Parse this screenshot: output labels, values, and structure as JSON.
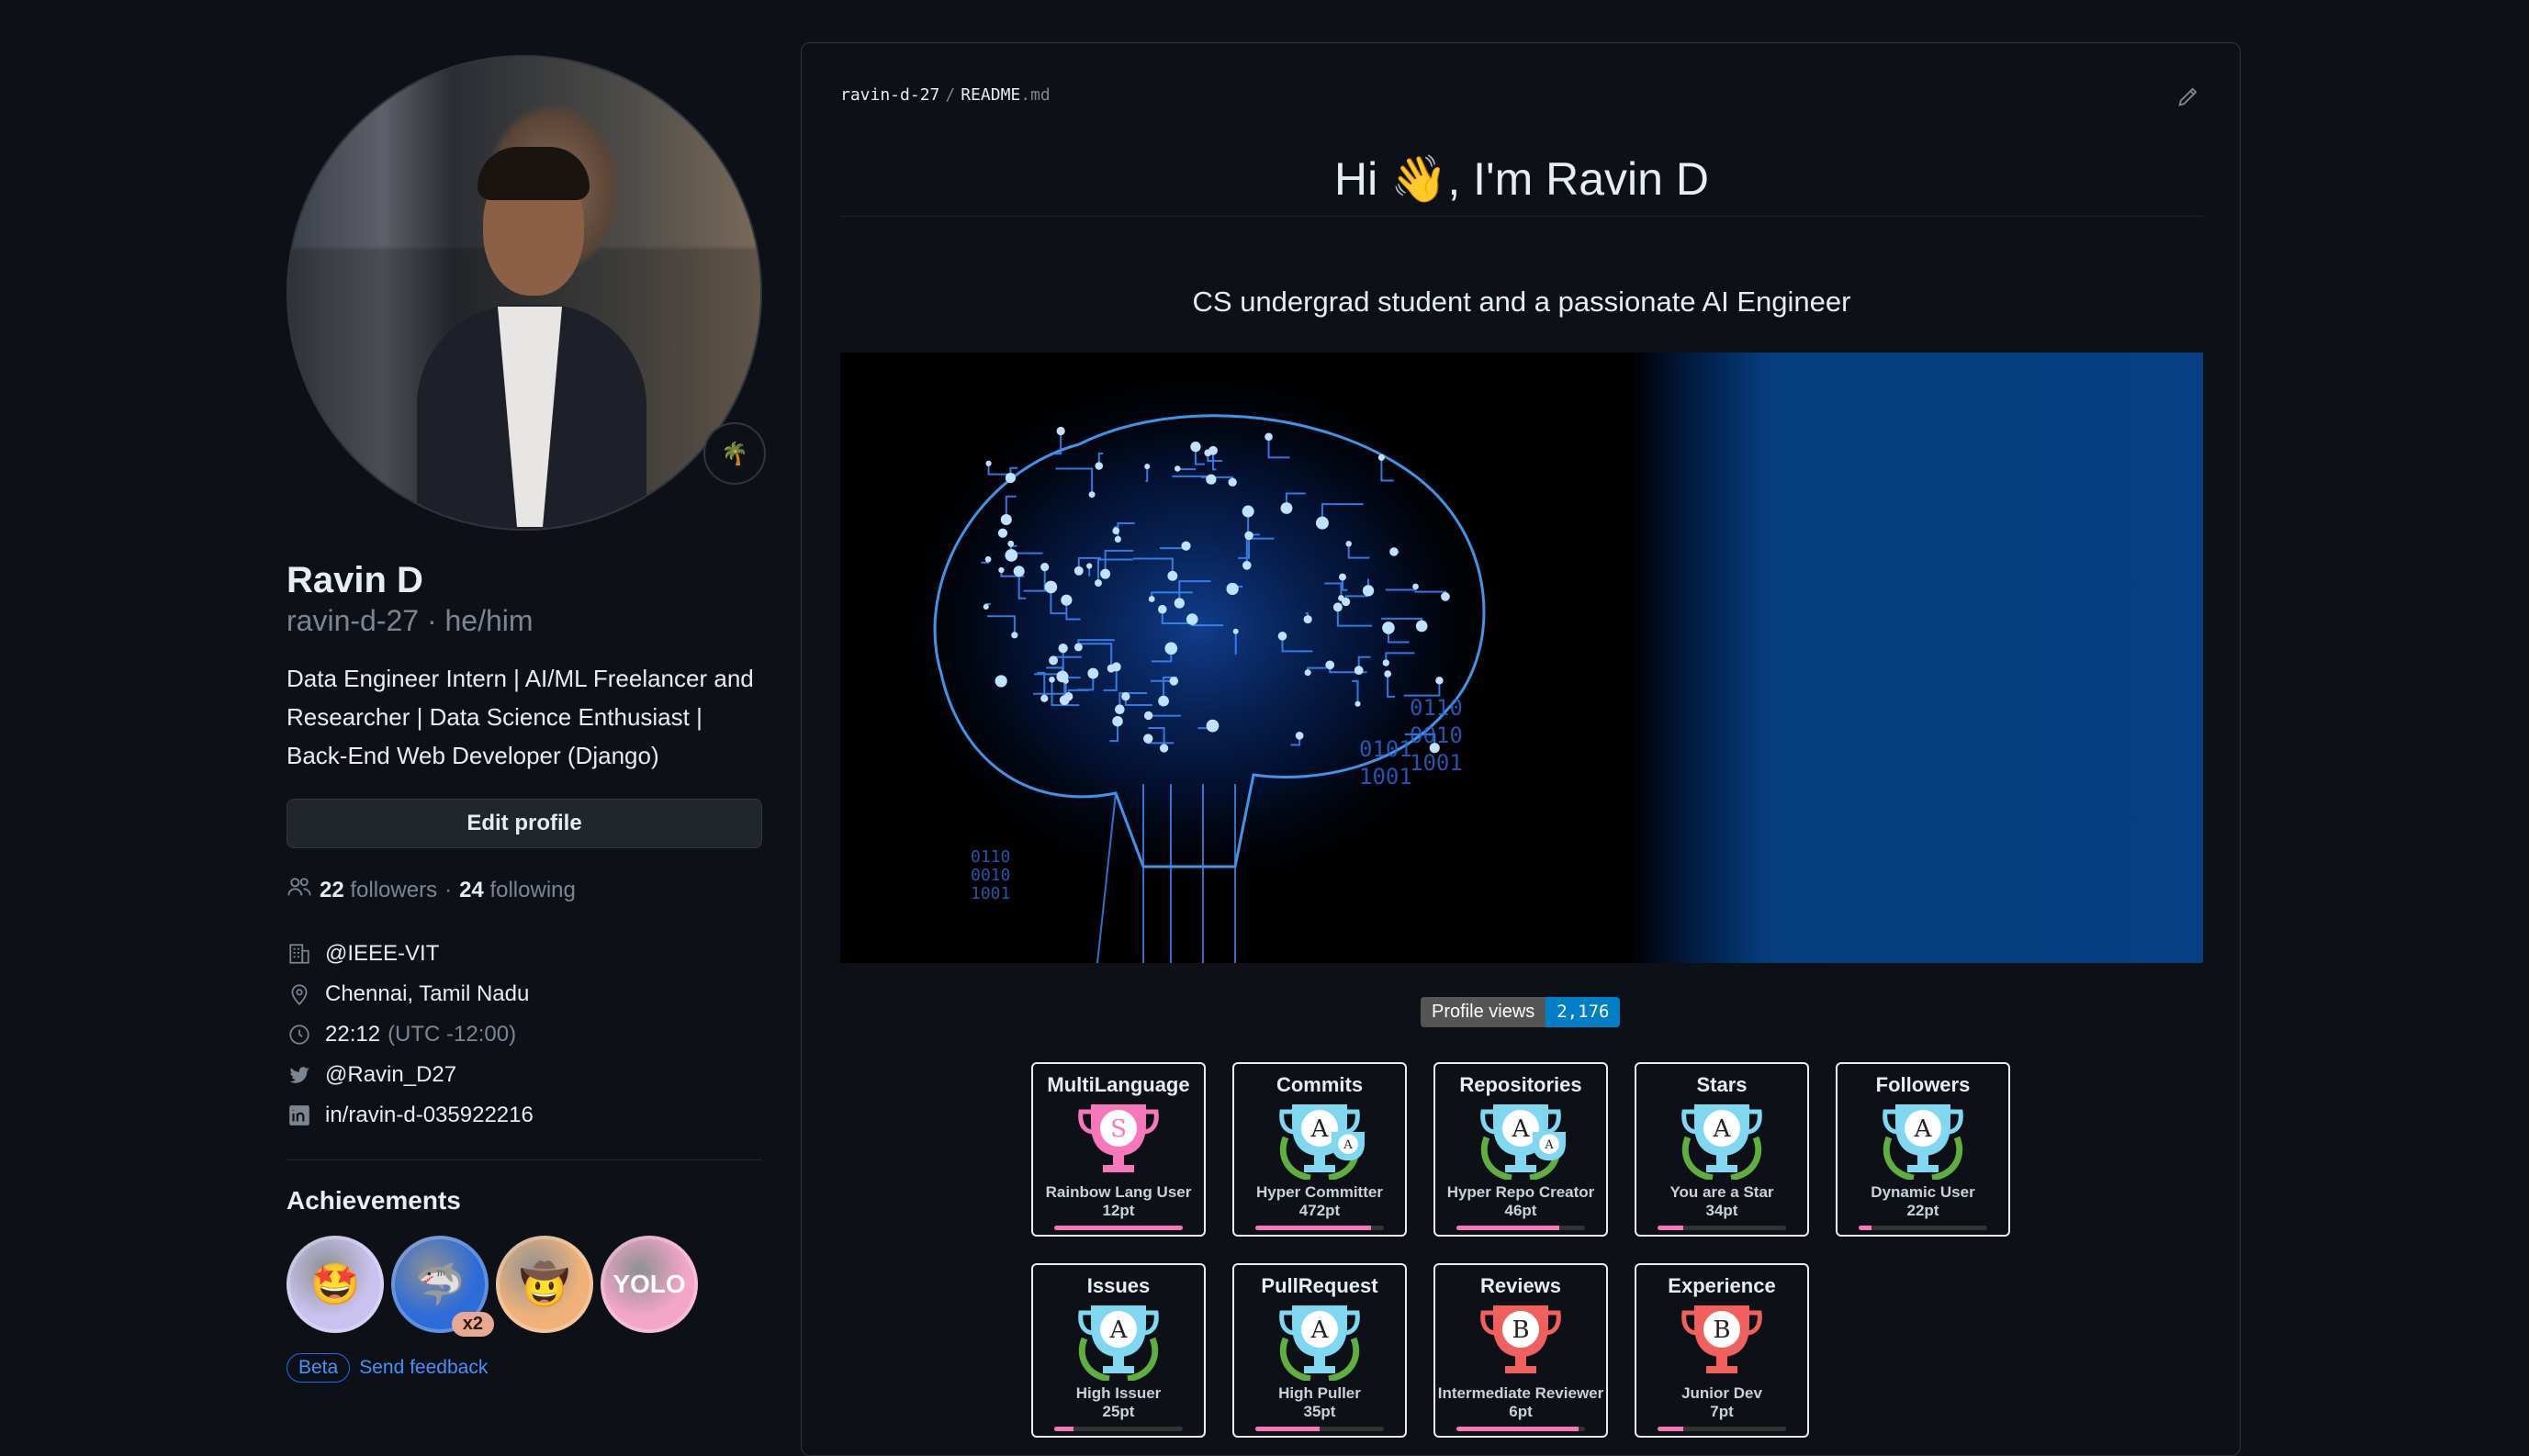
{
  "profile": {
    "name": "Ravin D",
    "handle_line": "ravin-d-27 · he/him",
    "bio": "Data Engineer Intern | AI/ML Freelancer and Researcher | Data Science Enthusiast | Back-End Web Developer (Django)",
    "status_emoji": "🌴",
    "edit_label": "Edit profile",
    "followers_count": "22",
    "followers_label": "followers",
    "dot": "·",
    "following_count": "24",
    "following_label": "following",
    "org": "@IEEE-VIT",
    "location": "Chennai, Tamil Nadu",
    "time": "22:12",
    "timezone": "(UTC -12:00)",
    "twitter": "@Ravin_D27",
    "linkedin": "in/ravin-d-035922216"
  },
  "achievements": {
    "title": "Achievements",
    "badges": [
      {
        "name": "starstruck",
        "icon": "🤩",
        "bg": "#c9c2f0"
      },
      {
        "name": "pull-shark",
        "icon": "🦈",
        "bg": "#2d6bd8",
        "count": "x2"
      },
      {
        "name": "pair-extraordinaire",
        "icon": "🤠",
        "bg": "#f0b27a"
      },
      {
        "name": "yolo",
        "icon": "YOLO",
        "bg": "#f4a6c8"
      }
    ],
    "beta_label": "Beta",
    "feedback_label": "Send feedback"
  },
  "readme": {
    "path_user": "ravin-d-27",
    "path_sep": "/",
    "path_file": "README",
    "path_ext": ".md",
    "heading": "Hi 👋, I'm Ravin D",
    "subtitle": "CS undergrad student and a passionate AI Engineer",
    "views_label": "Profile views",
    "views_value": "2,176",
    "hero_binary": [
      "0110",
      "0010",
      "1001",
      "0101",
      "1001"
    ]
  },
  "trophies": [
    {
      "title": "MultiLanguage",
      "rank": "S",
      "label": "Rainbow Lang User",
      "points": "12pt",
      "progress": 1.0,
      "cup": "#f778ba",
      "laurel": false
    },
    {
      "title": "Commits",
      "rank": "A",
      "label": "Hyper Committer",
      "points": "472pt",
      "progress": 0.9,
      "cup": "#7fd8f0",
      "laurel": true,
      "double": true
    },
    {
      "title": "Repositories",
      "rank": "A",
      "label": "Hyper Repo Creator",
      "points": "46pt",
      "progress": 0.8,
      "cup": "#7fd8f0",
      "laurel": true,
      "double": true
    },
    {
      "title": "Stars",
      "rank": "A",
      "label": "You are a Star",
      "points": "34pt",
      "progress": 0.2,
      "cup": "#7fd8f0",
      "laurel": true
    },
    {
      "title": "Followers",
      "rank": "A",
      "label": "Dynamic User",
      "points": "22pt",
      "progress": 0.1,
      "cup": "#7fd8f0",
      "laurel": true
    },
    {
      "title": "Issues",
      "rank": "A",
      "label": "High Issuer",
      "points": "25pt",
      "progress": 0.15,
      "cup": "#7fd8f0",
      "laurel": true
    },
    {
      "title": "PullRequest",
      "rank": "A",
      "label": "High Puller",
      "points": "35pt",
      "progress": 0.5,
      "cup": "#7fd8f0",
      "laurel": true
    },
    {
      "title": "Reviews",
      "rank": "B",
      "label": "Intermediate Reviewer",
      "points": "6pt",
      "progress": 0.95,
      "cup": "#f25f5f",
      "laurel": false
    },
    {
      "title": "Experience",
      "rank": "B",
      "label": "Junior Dev",
      "points": "7pt",
      "progress": 0.2,
      "cup": "#f25f5f",
      "laurel": false
    }
  ],
  "colors": {
    "background": "#0d1117",
    "link": "#4493f8",
    "muted": "#7d8590",
    "progress": "#f778ba"
  }
}
